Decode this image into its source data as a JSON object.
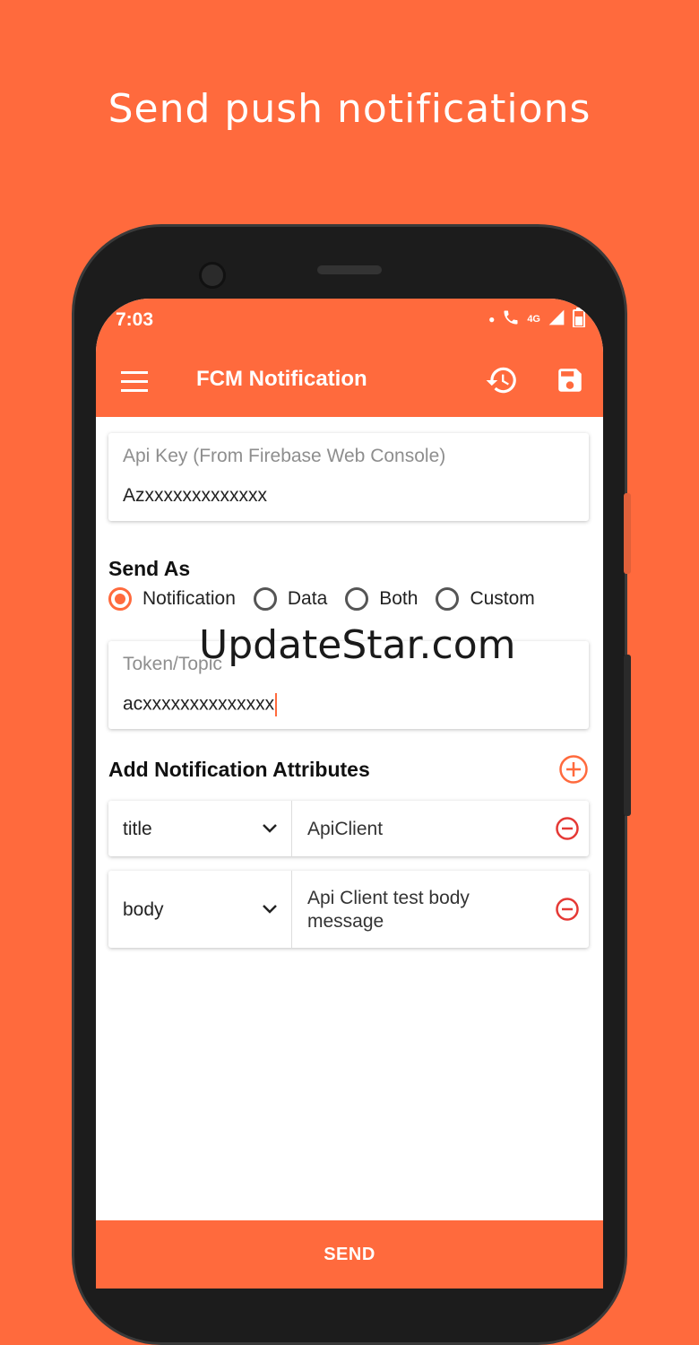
{
  "headline": "Send push notifications",
  "status_bar": {
    "time": "7:03",
    "network": "4G"
  },
  "app_bar": {
    "title": "FCM Notification"
  },
  "api_key": {
    "hint": "Api Key (From Firebase Web Console)",
    "value": "Azxxxxxxxxxxxxx"
  },
  "send_as": {
    "title": "Send As",
    "selected": "Notification",
    "options": [
      "Notification",
      "Data",
      "Both",
      "Custom"
    ]
  },
  "token": {
    "hint": "Token/Topic",
    "value": "acxxxxxxxxxxxxxx"
  },
  "attributes": {
    "title": "Add Notification Attributes",
    "rows": [
      {
        "key": "title",
        "value": "ApiClient"
      },
      {
        "key": "body",
        "value": "Api Client test body message"
      }
    ]
  },
  "send_button": "SEND",
  "watermark": "UpdateStar.com",
  "colors": {
    "accent": "#FF6A3D",
    "remove": "#E53935"
  }
}
